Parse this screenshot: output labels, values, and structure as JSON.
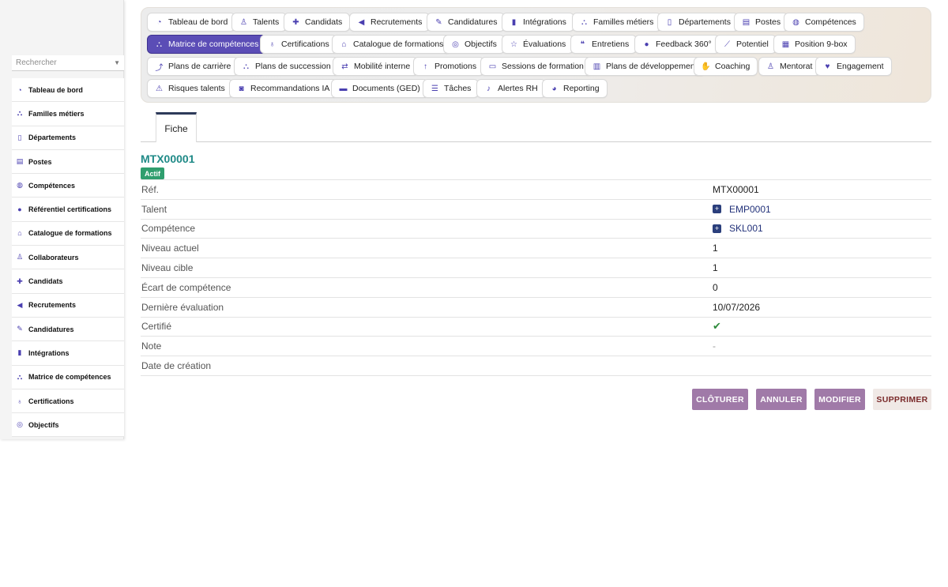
{
  "sidebar": {
    "search_placeholder": "Rechercher",
    "items": [
      {
        "label": "Tableau de bord",
        "icon": "dashboard-icon"
      },
      {
        "label": "Familles métiers",
        "icon": "sitemap-icon"
      },
      {
        "label": "Départements",
        "icon": "building-icon"
      },
      {
        "label": "Postes",
        "icon": "id-card-icon"
      },
      {
        "label": "Compétences",
        "icon": "brain-icon"
      },
      {
        "label": "Référentiel certifications",
        "icon": "circle-icon"
      },
      {
        "label": "Catalogue de formations",
        "icon": "graduation-cap-icon"
      },
      {
        "label": "Collaborateurs",
        "icon": "user-icon"
      },
      {
        "label": "Candidats",
        "icon": "user-plus-icon"
      },
      {
        "label": "Recrutements",
        "icon": "megaphone-icon"
      },
      {
        "label": "Candidatures",
        "icon": "file-signature-icon"
      },
      {
        "label": "Intégrations",
        "icon": "door-icon"
      },
      {
        "label": "Matrice de compétences",
        "icon": "sitemap-icon"
      },
      {
        "label": "Certifications",
        "icon": "award-icon"
      },
      {
        "label": "Objectifs",
        "icon": "bullseye-icon"
      }
    ]
  },
  "topnav": {
    "rows": [
      [
        {
          "label": "Tableau de bord",
          "icon": "dashboard-icon"
        },
        {
          "label": "Talents",
          "icon": "user-icon"
        },
        {
          "label": "Candidats",
          "icon": "user-plus-icon"
        },
        {
          "label": "Recrutements",
          "icon": "megaphone-icon"
        },
        {
          "label": "Candidatures",
          "icon": "file-signature-icon"
        },
        {
          "label": "Intégrations",
          "icon": "door-icon"
        },
        {
          "label": "Familles métiers",
          "icon": "sitemap-icon"
        },
        {
          "label": "Départements",
          "icon": "building-icon"
        },
        {
          "label": "Postes",
          "icon": "id-card-icon"
        },
        {
          "label": "Compétences",
          "icon": "brain-icon"
        }
      ],
      [
        {
          "label": "Matrice de compétences",
          "icon": "sitemap-icon",
          "active": true
        },
        {
          "label": "Certifications",
          "icon": "award-icon"
        },
        {
          "label": "Catalogue de formations",
          "icon": "graduation-cap-icon"
        },
        {
          "label": "Objectifs",
          "icon": "bullseye-icon"
        },
        {
          "label": "Évaluations",
          "icon": "star-icon"
        },
        {
          "label": "Entretiens",
          "icon": "comments-icon"
        },
        {
          "label": "Feedback 360°",
          "icon": "comment-icon"
        },
        {
          "label": "Potentiel",
          "icon": "chart-line-icon"
        },
        {
          "label": "Position 9-box",
          "icon": "grid-icon"
        }
      ],
      [
        {
          "label": "Plans de carrière",
          "icon": "route-icon"
        },
        {
          "label": "Plans de succession",
          "icon": "sitemap-icon"
        },
        {
          "label": "Mobilité interne",
          "icon": "exchange-icon"
        },
        {
          "label": "Promotions",
          "icon": "arrow-up-icon"
        },
        {
          "label": "Sessions de formation",
          "icon": "chalkboard-icon"
        },
        {
          "label": "Plans de développement",
          "icon": "clipboard-icon"
        },
        {
          "label": "Coaching",
          "icon": "handshake-icon"
        },
        {
          "label": "Mentorat",
          "icon": "user-tie-icon"
        },
        {
          "label": "Engagement",
          "icon": "heart-icon"
        }
      ],
      [
        {
          "label": "Risques talents",
          "icon": "warning-icon"
        },
        {
          "label": "Recommandations IA",
          "icon": "robot-icon"
        },
        {
          "label": "Documents (GED)",
          "icon": "folder-icon"
        },
        {
          "label": "Tâches",
          "icon": "list-icon"
        },
        {
          "label": "Alertes RH",
          "icon": "bell-icon"
        },
        {
          "label": "Reporting",
          "icon": "pie-chart-icon"
        }
      ]
    ]
  },
  "tabs": [
    {
      "label": "Fiche"
    }
  ],
  "record": {
    "title": "MTX00001",
    "status": "Actif",
    "fields": [
      {
        "label": "Réf.",
        "value": "MTX00001"
      },
      {
        "label": "Talent",
        "value": "EMP0001",
        "link": true
      },
      {
        "label": "Compétence",
        "value": "SKL001",
        "link": true
      },
      {
        "label": "Niveau actuel",
        "value": "1"
      },
      {
        "label": "Niveau cible",
        "value": "1"
      },
      {
        "label": "Écart de compétence",
        "value": "0"
      },
      {
        "label": "Dernière évaluation",
        "value": "10/07/2026"
      },
      {
        "label": "Certifié",
        "value": "✔",
        "check": true
      },
      {
        "label": "Note",
        "value": "-",
        "muted": true
      },
      {
        "label": "Date de création",
        "value": ""
      }
    ]
  },
  "actions": {
    "close": "CLÔTURER",
    "cancel": "ANNULER",
    "edit": "MODIFIER",
    "delete": "SUPPRIMER"
  },
  "colors": {
    "accent": "#5b4db6",
    "title": "#1f8a87",
    "badge": "#2f9e6e",
    "action": "#a07aa8"
  }
}
